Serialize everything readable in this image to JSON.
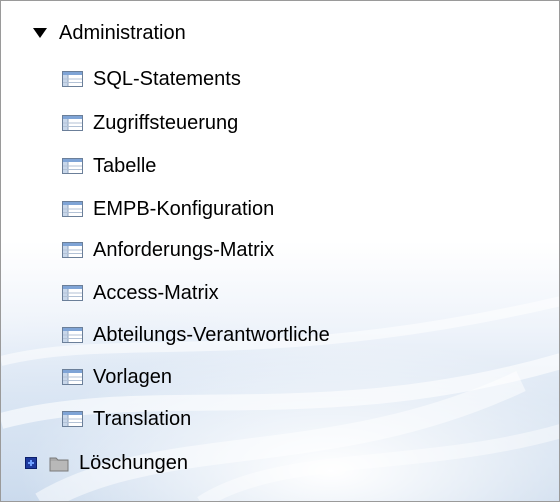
{
  "tree": {
    "root": {
      "label": "Administration",
      "icon": "triangle-down-icon",
      "expanded": true
    },
    "items": [
      {
        "label": "SQL-Statements",
        "icon": "table-icon"
      },
      {
        "label": "Zugriffsteuerung",
        "icon": "table-icon"
      },
      {
        "label": "Tabelle",
        "icon": "table-icon"
      },
      {
        "label": "EMPB-Konfiguration",
        "icon": "table-icon"
      },
      {
        "label": "Anforderungs-Matrix",
        "icon": "table-icon"
      },
      {
        "label": "Access-Matrix",
        "icon": "table-icon"
      },
      {
        "label": "Abteilungs-Verantwortliche",
        "icon": "table-icon"
      },
      {
        "label": "Vorlagen",
        "icon": "table-icon"
      },
      {
        "label": "Translation",
        "icon": "table-icon"
      }
    ],
    "collapsed_folder": {
      "label": "Löschungen",
      "expander_icon": "plus-expander-icon",
      "icon": "folder-icon",
      "expanded": false
    }
  },
  "colors": {
    "text": "#000000",
    "expander": "#1f3a9e",
    "background_bottom": "#c9d9ec"
  }
}
